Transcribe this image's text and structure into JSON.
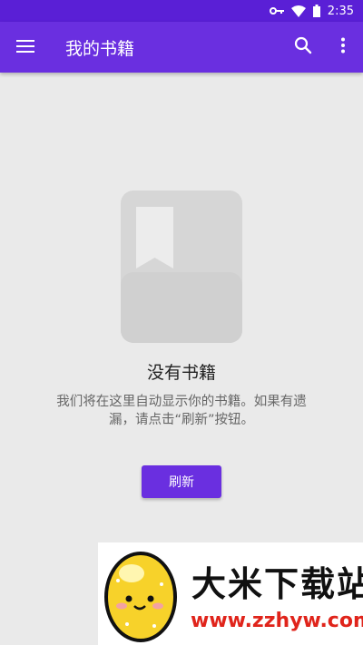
{
  "status_bar": {
    "time": "2:35"
  },
  "app_bar": {
    "title": "我的书籍"
  },
  "empty_state": {
    "title": "没有书籍",
    "description": "我们将在这里自动显示你的书籍。如果有遗漏，请点击“刷新”按钮。",
    "button_label": "刷新"
  },
  "watermark": {
    "name": "大米下载站",
    "url": "www.zzhyw.com"
  },
  "icons": [
    "key-icon",
    "wifi-icon",
    "battery-icon",
    "menu-icon",
    "search-icon",
    "more-vert-icon",
    "bookmark-book-icon"
  ],
  "colors": {
    "primary": "#6a2fe0",
    "status_bar": "#5a1fd6",
    "background": "#eaeaea",
    "watermark_url": "#e0241b"
  }
}
